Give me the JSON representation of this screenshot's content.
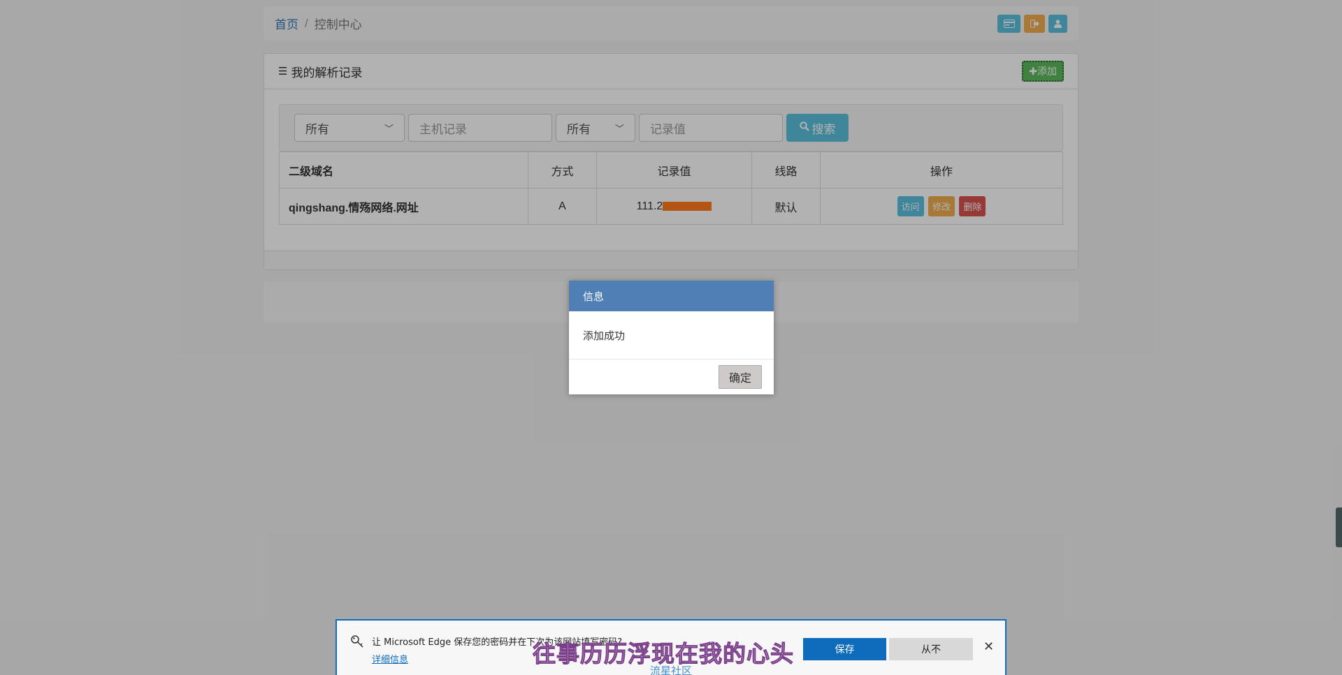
{
  "breadcrumb": {
    "home": "首页",
    "separator": "/",
    "current": "控制中心"
  },
  "top_icons": [
    "card-icon",
    "sign-out-icon",
    "user-icon"
  ],
  "panel": {
    "title": "我的解析记录",
    "add_label": "✚添加"
  },
  "filters": {
    "type_select_value": "所有",
    "host_placeholder": "主机记录",
    "line_select_value": "所有",
    "value_placeholder": "记录值",
    "search_label": "搜索"
  },
  "table": {
    "headers": [
      "二级域名",
      "方式",
      "记录值",
      "线路",
      "操作"
    ],
    "rows": [
      {
        "domain": "qingshang.情殇网络.网址",
        "type": "A",
        "value_prefix": "111.2",
        "line": "默认"
      }
    ],
    "actions": {
      "visit": "访问",
      "edit": "修改",
      "delete": "删除"
    }
  },
  "dialog": {
    "title": "信息",
    "message": "添加成功",
    "ok": "确定"
  },
  "edge_prompt": {
    "message": "让 Microsoft Edge 保存您的密码并在下次为该网站填写密码?",
    "details": "详细信息",
    "save": "保存",
    "never": "从不"
  },
  "watermark": {
    "lyric": "往事历历浮现在我的心头",
    "community": "流星社区"
  },
  "colors": {
    "info": "#5bc0de",
    "warning": "#f0ad4e",
    "success": "#5cb85c",
    "danger": "#d9534f",
    "dialog_header": "#4f7fb5",
    "edge_blue": "#0f6cbd"
  }
}
